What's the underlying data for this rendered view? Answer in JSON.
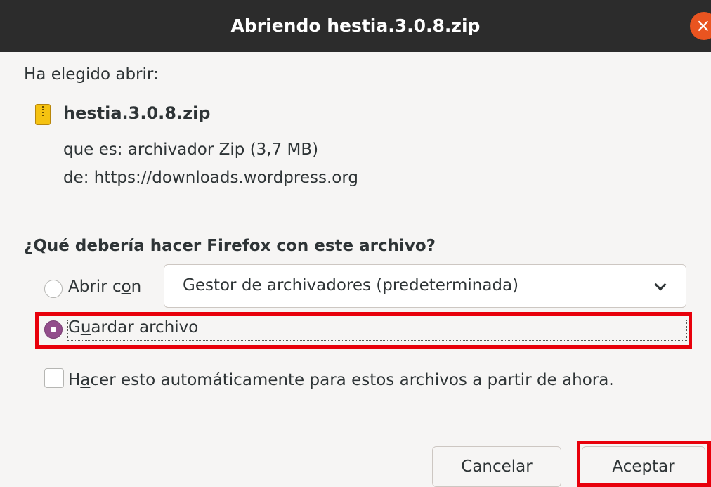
{
  "window": {
    "title": "Abriendo hestia.3.0.8.zip",
    "close_glyph": "×",
    "close_icon": "close-icon",
    "close_color": "#e95420"
  },
  "file": {
    "intro": "Ha elegido abrir:",
    "name": "hestia.3.0.8.zip",
    "icon": "zip-archive-icon",
    "type_line": "que es: archivador Zip (3,7 MB)",
    "source_line": "de: https://downloads.wordpress.org"
  },
  "question": "¿Qué debería hacer Firefox con este archivo?",
  "options": {
    "open_with": {
      "label_before": "Abrir c",
      "mnemonic": "o",
      "label_after": "n",
      "selected": false
    },
    "application_select": {
      "value": "Gestor de archivadores (predeterminada)"
    },
    "save_file": {
      "label_before": "G",
      "mnemonic": "u",
      "label_after": "ardar archivo",
      "selected": true
    },
    "auto_checkbox": {
      "label_before": "H",
      "mnemonic": "a",
      "label_after": "cer esto automáticamente para estos archivos a partir de ahora.",
      "checked": false
    }
  },
  "buttons": {
    "cancel": "Cancelar",
    "accept": "Aceptar"
  },
  "colors": {
    "radio_selected": "#924d8b",
    "annotation_highlight": "#e8000b",
    "titlebar": "#2c2c2c"
  }
}
